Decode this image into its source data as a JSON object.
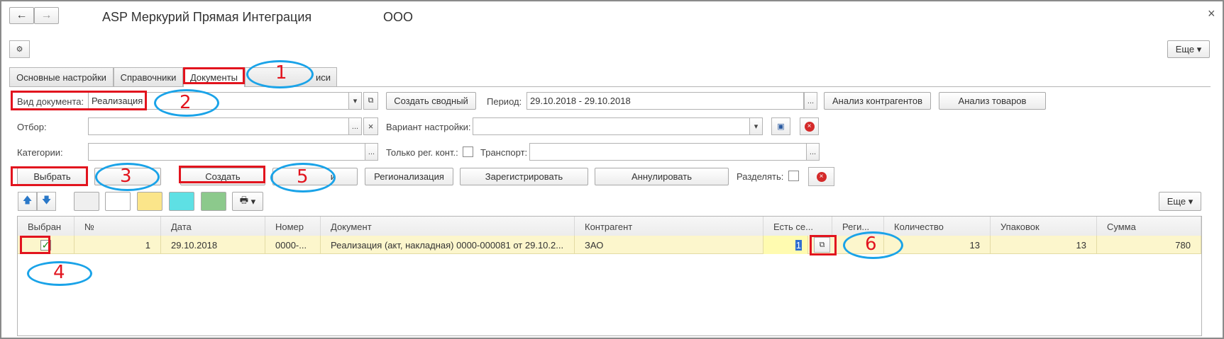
{
  "window": {
    "title": "ASP Меркурий Прямая Интеграция",
    "org": "ООО",
    "close_glyph": "×"
  },
  "toolbar": {
    "more_label": "Еще"
  },
  "tabs": [
    {
      "label": "Основные настройки",
      "active": false
    },
    {
      "label": "Справочники",
      "active": false
    },
    {
      "label": "Документы",
      "active": true
    },
    {
      "label": "иси",
      "active": false
    }
  ],
  "filters": {
    "doc_type_label": "Вид документа:",
    "doc_type_value": "Реализация",
    "create_summary_label": "Создать сводный",
    "period_label": "Период:",
    "period_value": "29.10.2018 - 29.10.2018",
    "analysis_contractors_label": "Анализ контрагентов",
    "analysis_goods_label": "Анализ товаров",
    "filter_label": "Отбор:",
    "variant_label": "Вариант настройки:",
    "categories_label": "Категории:",
    "only_reg_label": "Только рег. конт.:",
    "transport_label": "Транспорт:",
    "ellipsis": "...",
    "clear_glyph": "×"
  },
  "actions": {
    "select_label": "Выбрать",
    "create_label": "Создать",
    "partial_label": "и",
    "regionalization_label": "Регионализация",
    "register_label": "Зарегистрировать",
    "cancel_label": "Аннулировать",
    "split_label": "Разделять:"
  },
  "table_toolbar": {
    "more_label": "Еще",
    "swatch_colors": [
      "#efefef",
      "#ffffff",
      "#fbe58a",
      "#5ee0e4",
      "#8cc98c"
    ]
  },
  "table": {
    "columns": [
      "Выбран",
      "№",
      "Дата",
      "Номер",
      "Документ",
      "Контрагент",
      "Есть се...",
      "Реги...",
      "Количество",
      "Упаковок",
      "Сумма"
    ],
    "rows": [
      {
        "selected": true,
        "n": "1",
        "date": "29.10.2018",
        "number": "0000-...",
        "document": "Реализация (акт, накладная) 0000-000081 от 29.10.2...",
        "contractor": "ЗАО",
        "has_cert": "1",
        "region": "",
        "qty": "13",
        "packs": "13",
        "sum": "780"
      }
    ]
  },
  "annotations": {
    "numbers": [
      "1",
      "2",
      "3",
      "4",
      "5",
      "6"
    ],
    "ellipse_color": "#1aa3e8",
    "box_color": "#e2141e"
  }
}
